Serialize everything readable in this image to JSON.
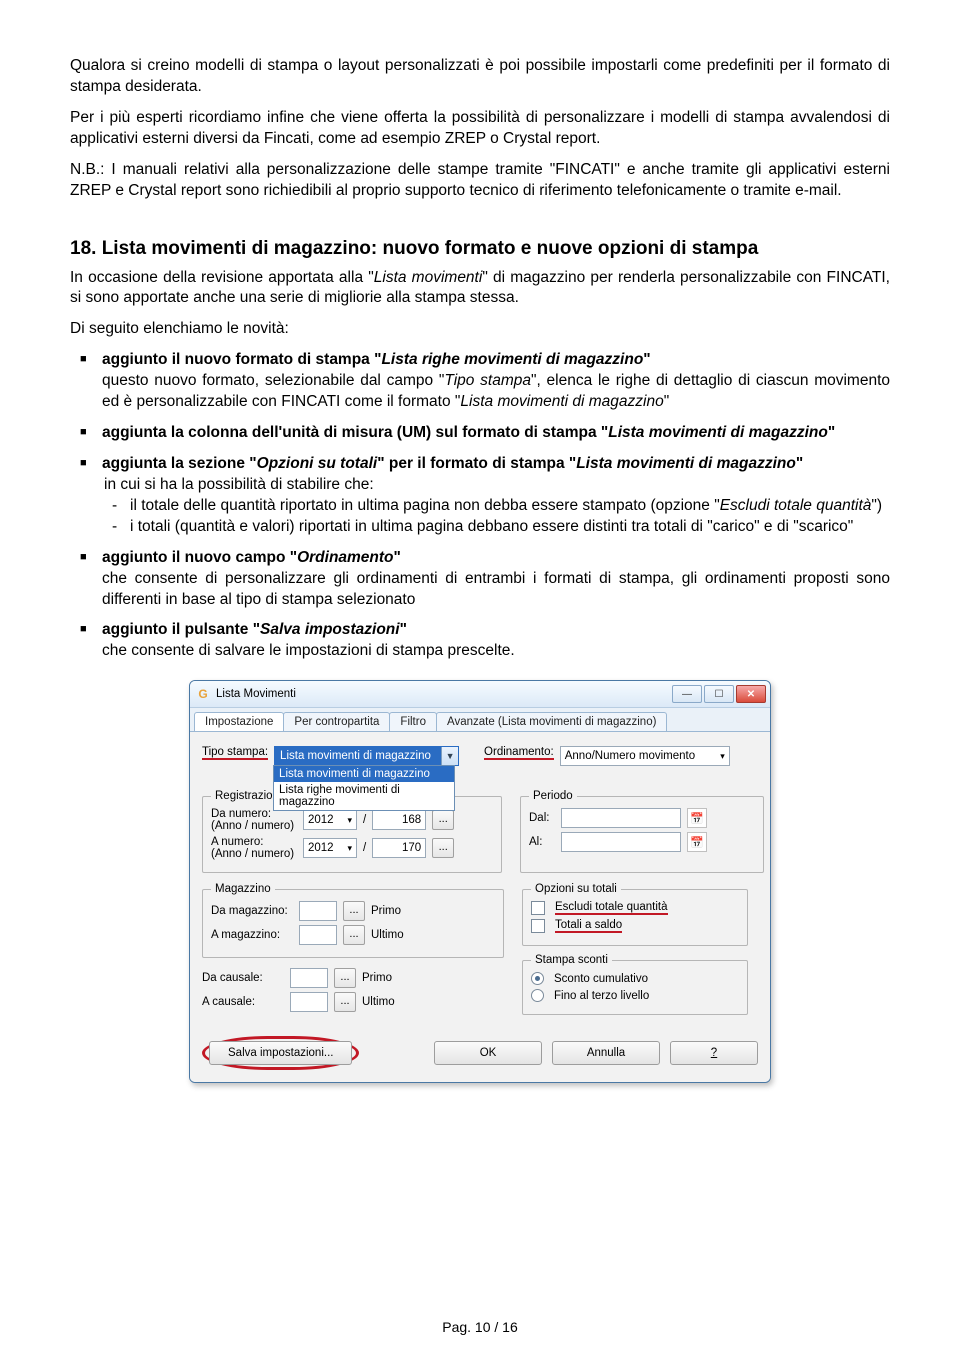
{
  "para1": "Qualora si creino modelli di stampa o layout personalizzati è poi possibile impostarli come predefiniti per il formato di stampa desiderata.",
  "para2": "Per i più esperti ricordiamo infine che viene offerta la possibilità di personalizzare i modelli di stampa avvalendosi di applicativi esterni diversi da Fincati, come ad esempio ZREP o Crystal report.",
  "nb": "N.B.: I manuali relativi alla personalizzazione delle stampe tramite \"FINCATI\" e anche tramite gli applicativi esterni ZREP e Crystal report sono richiedibili al proprio supporto tecnico di riferimento telefonicamente o tramite e-mail.",
  "sec_title": "18. Lista movimenti di magazzino: nuovo formato e nuove opzioni di stampa",
  "sec_p1a": "In occasione della revisione apportata alla \"",
  "sec_p1b": "Lista movimenti",
  "sec_p1c": "\" di magazzino per renderla personalizzabile con FINCATI, si sono apportate anche una serie di migliorie alla stampa stessa.",
  "sec_p2": "Di seguito elenchiamo le novità:",
  "b1_a": "aggiunto il nuovo formato di stampa \"",
  "b1_b": "Lista righe movimenti di magazzino",
  "b1_c": "\"",
  "b1_sub_a": "questo nuovo formato, selezionabile dal campo \"",
  "b1_sub_b": "Tipo stampa",
  "b1_sub_c": "\", elenca le righe di dettaglio di ciascun movimento ed è personalizzabile con FINCATI come il formato \"",
  "b1_sub_d": "Lista movimenti di magazzino",
  "b1_sub_e": "\"",
  "b2_a": "aggiunta la colonna dell'unità di misura (UM) sul formato di stampa \"",
  "b2_b": "Lista movimenti di magazzino",
  "b2_c": "\"",
  "b3_a": "aggiunta la sezione \"",
  "b3_b": "Opzioni su totali",
  "b3_c": "\" per il formato di stampa \"",
  "b3_d": "Lista movimenti di magazzino",
  "b3_e": "\"",
  "b3_sub": "in cui si ha la possibilità di stabilire che:",
  "b3_d1_a": "il totale delle quantità riportato in ultima pagina non debba essere stampato (opzione \"",
  "b3_d1_b": "Escludi totale quantità",
  "b3_d1_c": "\")",
  "b3_d2": "i totali (quantità e valori) riportati in ultima pagina debbano essere distinti tra totali di \"carico\" e  di \"scarico\"",
  "b4_a": "aggiunto il nuovo campo \"",
  "b4_b": "Ordinamento",
  "b4_c": "\"",
  "b4_sub": "che consente di personalizzare gli ordinamenti di entrambi i formati di stampa, gli ordinamenti proposti sono differenti in base al tipo di stampa selezionato",
  "b5_a": "aggiunto il pulsante \"",
  "b5_b": "Salva impostazioni",
  "b5_c": "\"",
  "b5_sub": "che consente di salvare le impostazioni di stampa prescelte.",
  "footer": "Pag. 10 / 16",
  "dialog": {
    "title": "Lista Movimenti",
    "tabs": [
      "Impostazione",
      "Per contropartita",
      "Filtro",
      "Avanzate (Lista movimenti di magazzino)"
    ],
    "tipo_stampa_label": "Tipo stampa:",
    "tipo_stampa_value": "Lista movimenti di magazzino",
    "tipo_stampa_opt1": "Lista movimenti di magazzino",
    "tipo_stampa_opt2": "Lista righe movimenti di magazzino",
    "ordinamento_label": "Ordinamento:",
    "ordinamento_value": "Anno/Numero movimento",
    "registrazioni": "Registrazioni",
    "periodo": "Periodo",
    "da_numero": "Da numero:\n(Anno / numero)",
    "a_numero": "A numero:\n(Anno / numero)",
    "anno1": "2012",
    "num1": "168",
    "anno2": "2012",
    "num2": "170",
    "dal": "Dal:",
    "al": "Al:",
    "magazzino_legend": "Magazzino",
    "da_magazzino": "Da magazzino:",
    "a_magazzino": "A magazzino:",
    "primo": "Primo",
    "ultimo": "Ultimo",
    "da_causale": "Da causale:",
    "a_causale": "A causale:",
    "opzioni_totali": "Opzioni su totali",
    "escludi": "Escludi totale quantità",
    "totali_saldo": "Totali a saldo",
    "stampa_sconti": "Stampa sconti",
    "sconto_cumulativo": "Sconto cumulativo",
    "fino_terzo": "Fino al terzo livello",
    "salva": "Salva impostazioni...",
    "ok": "OK",
    "annulla": "Annulla",
    "help": "?",
    "slash": "/",
    "dots": "..."
  }
}
